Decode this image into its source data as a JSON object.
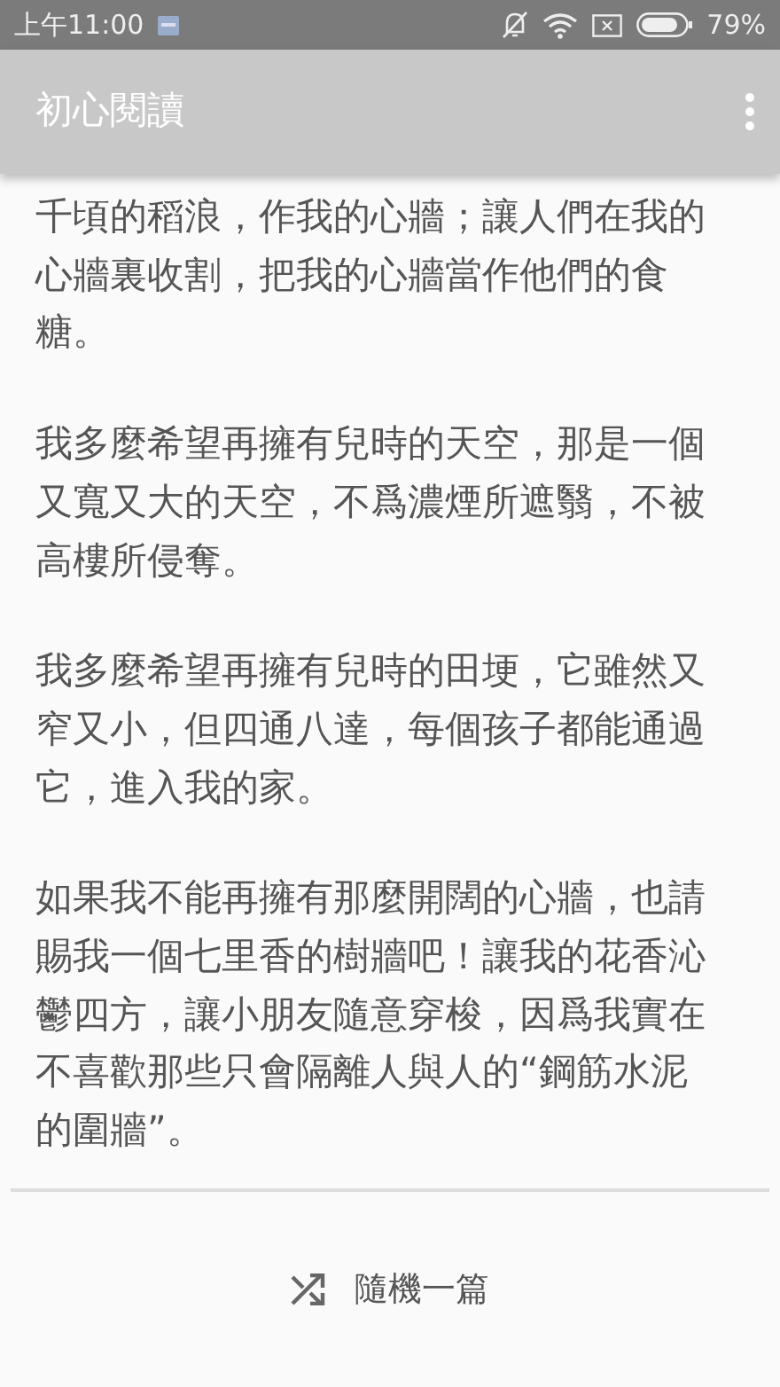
{
  "status_bar": {
    "time": "上午11:00",
    "battery": "79%"
  },
  "app_bar": {
    "title": "初心閱讀"
  },
  "article": {
    "paragraphs": [
      "千頃的稻浪，作我的心牆；讓人們在我的心牆裏收割，把我的心牆當作他們的食糖。",
      "我多麼希望再擁有兒時的天空，那是一個又寬又大的天空，不爲濃煙所遮翳，不被高樓所侵奪。",
      "我多麼希望再擁有兒時的田埂，它雖然又窄又小，但四通八達，每個孩子都能通過它，進入我的家。",
      "如果我不能再擁有那麼開闊的心牆，也請賜我一個七里香的樹牆吧！讓我的花香沁鬱四方，讓小朋友隨意穿梭，因爲我實在不喜歡那些只會隔離人與人的“鋼筋水泥的圍牆”。"
    ]
  },
  "random_button": {
    "label": "隨機一篇"
  }
}
